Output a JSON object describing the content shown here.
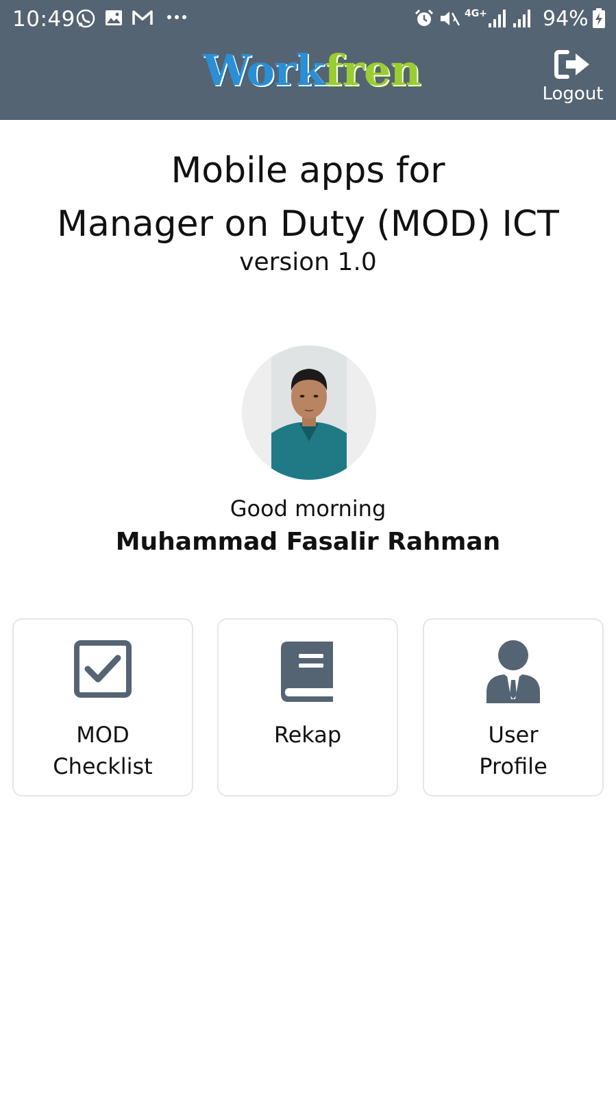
{
  "status_bar": {
    "time": "10:49",
    "network": "4G+",
    "battery": "94%",
    "icons": [
      "whatsapp-icon",
      "gallery-icon",
      "gmail-icon",
      "more-icon",
      "alarm-icon",
      "mute-icon",
      "signal-icon",
      "battery-charging-icon"
    ]
  },
  "header": {
    "logo_part1": "Work",
    "logo_part2": "fren",
    "logout_label": "Logout",
    "background": "#556473"
  },
  "main": {
    "title_line1": "Mobile apps for",
    "title_line2": "Manager on Duty (MOD) ICT",
    "version": "version 1.0",
    "greeting": "Good morning",
    "user_name": "Muhammad Fasalir Rahman"
  },
  "menu": [
    {
      "line1": "MOD",
      "line2": "Checklist",
      "icon": "checkbox-icon"
    },
    {
      "line1": "Rekap",
      "line2": "",
      "icon": "book-icon"
    },
    {
      "line1": "User",
      "line2": "Profile",
      "icon": "user-tie-icon"
    }
  ],
  "colors": {
    "icon": "#556473",
    "logo_blue": "#2a8fd6",
    "logo_green": "#9acd32"
  }
}
